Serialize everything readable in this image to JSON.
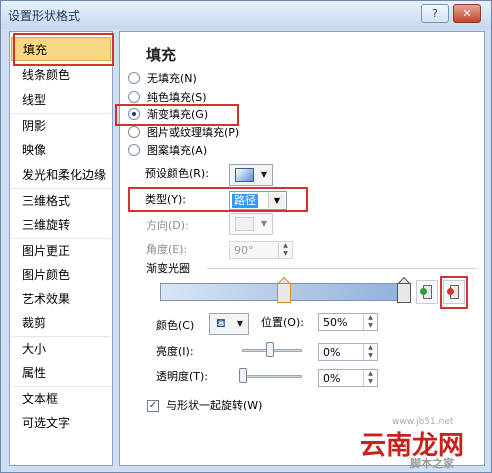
{
  "window": {
    "title": "设置形状格式",
    "help_glyph": "?",
    "close_glyph": "✕"
  },
  "sidebar": {
    "items": [
      {
        "label": "填充"
      },
      {
        "label": "线条颜色"
      },
      {
        "label": "线型"
      },
      {
        "label": "阴影"
      },
      {
        "label": "映像"
      },
      {
        "label": "发光和柔化边缘"
      },
      {
        "label": "三维格式"
      },
      {
        "label": "三维旋转"
      },
      {
        "label": "图片更正"
      },
      {
        "label": "图片颜色"
      },
      {
        "label": "艺术效果"
      },
      {
        "label": "裁剪"
      },
      {
        "label": "大小"
      },
      {
        "label": "属性"
      },
      {
        "label": "文本框"
      },
      {
        "label": "可选文字"
      }
    ]
  },
  "fill": {
    "heading": "填充",
    "options": [
      {
        "label": "无填充(N)",
        "checked": false
      },
      {
        "label": "纯色填充(S)",
        "checked": false
      },
      {
        "label": "渐变填充(G)",
        "checked": true
      },
      {
        "label": "图片或纹理填充(P)",
        "checked": false
      },
      {
        "label": "图案填充(A)",
        "checked": false
      }
    ],
    "preset_label": "预设颜色(R):",
    "type_label": "类型(Y):",
    "type_value": "路径",
    "direction_label": "方向(D):",
    "angle_label": "角度(E):",
    "angle_value": "90°",
    "stops_label": "渐变光圈",
    "color_label": "颜色(C)",
    "position_label": "位置(O):",
    "position_value": "50%",
    "brightness_label": "亮度(I):",
    "brightness_value": "0%",
    "transparency_label": "透明度(T):",
    "transparency_value": "0%",
    "rotate_label": "与形状一起旋转(W)",
    "rotate_checked": true
  },
  "watermark": {
    "main": "云南龙网",
    "sub": "脚本之家",
    "url": "www.jb51.net"
  },
  "colors": {
    "highlight": "#d23232",
    "selected_bg": "#f8d783",
    "accent": "#3399ff"
  }
}
